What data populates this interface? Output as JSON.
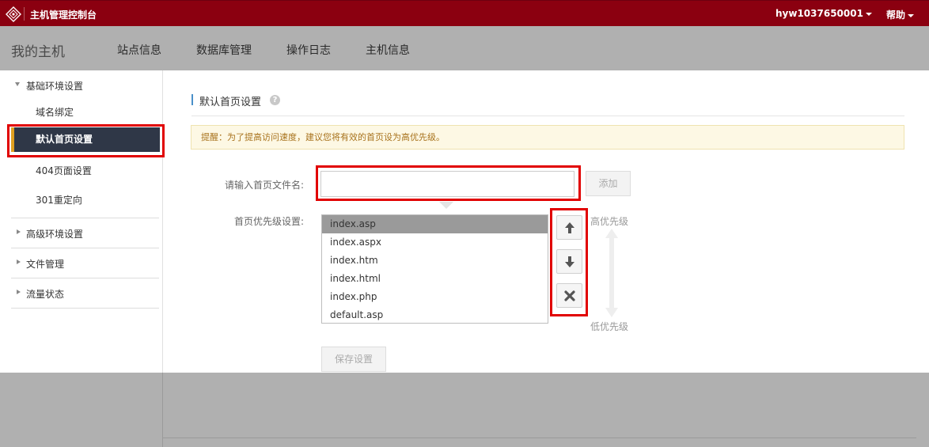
{
  "topbar": {
    "app_title": "主机管理控制台",
    "username": "hyw1037650001",
    "help": "帮助"
  },
  "navbar": {
    "brand": "我的主机",
    "items": [
      {
        "label": "站点信息"
      },
      {
        "label": "数据库管理"
      },
      {
        "label": "操作日志"
      },
      {
        "label": "主机信息"
      }
    ]
  },
  "sidebar": {
    "group_basic": "基础环境设置",
    "items": [
      {
        "label": "域名绑定"
      },
      {
        "label": "默认首页设置"
      },
      {
        "label": "404页面设置"
      },
      {
        "label": "301重定向"
      }
    ],
    "group_advanced": "高级环境设置",
    "group_files": "文件管理",
    "group_traffic": "流量状态"
  },
  "main": {
    "section_title": "默认首页设置",
    "help_glyph": "?",
    "notice": "提醒：为了提高访问速度，建议您将有效的首页设为高优先级。",
    "input_label": "请输入首页文件名:",
    "input_value": "",
    "add_label": "添加",
    "priority_label": "首页优先级设置:",
    "files": [
      "index.asp",
      "index.aspx",
      "index.htm",
      "index.html",
      "index.php",
      "default.asp"
    ],
    "selected_index": 0,
    "high_priority": "高优先级",
    "low_priority": "低优先级",
    "save_label": "保存设置"
  },
  "colors": {
    "topbar": "#8b0010",
    "nav_gray": "#b0b0b0",
    "active_item": "#2f3747",
    "active_accent": "#e0a020",
    "highlight": "#e10000"
  }
}
